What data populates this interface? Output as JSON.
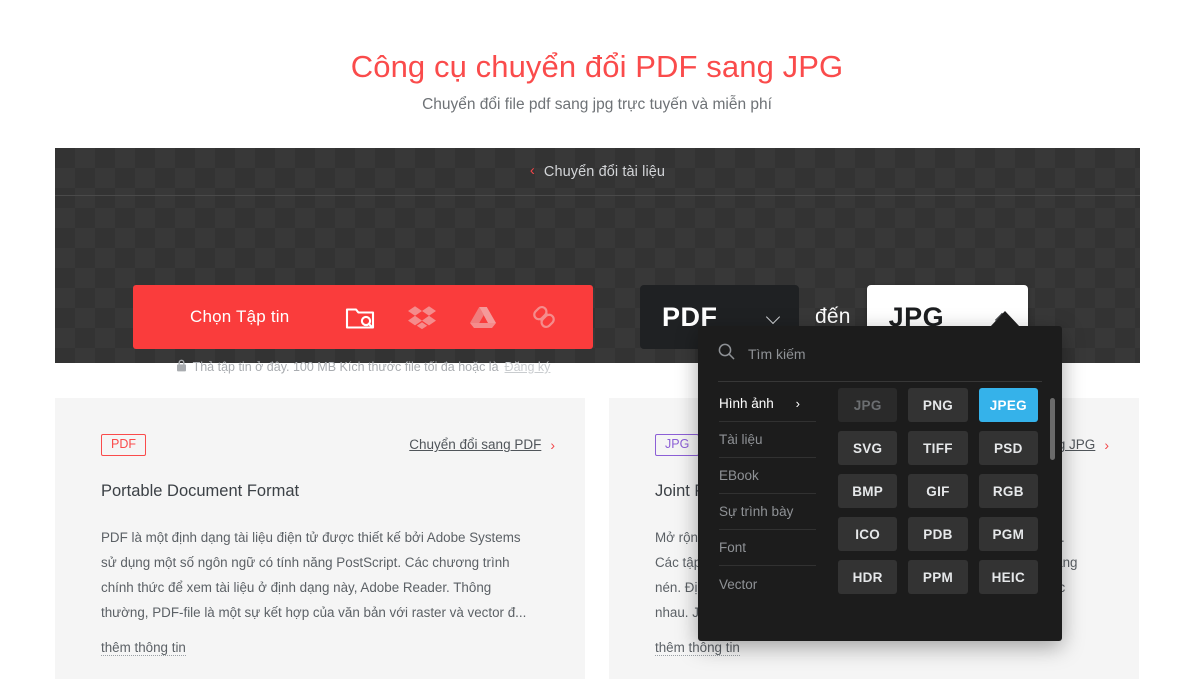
{
  "hero": {
    "title": "Công cụ chuyển đổi PDF sang JPG",
    "subtitle": "Chuyển đổi file pdf sang jpg trực tuyến và miễn phí"
  },
  "tool": {
    "header_label": "Chuyển đổi tài liệu",
    "back_chevron": "‹",
    "choose_button_label": "Chọn Tập tin",
    "source_icons": [
      {
        "name": "folder-search-icon"
      },
      {
        "name": "dropbox-icon"
      },
      {
        "name": "google-drive-icon"
      },
      {
        "name": "link-icon"
      }
    ],
    "drop_hint_text": "Thả tập tin ở đây. 100 MB Kích thước file tối đa hoặc là",
    "drop_hint_link": "Đăng ký",
    "lock_icon": "lock-icon",
    "format_from": "PDF",
    "format_to": "JPG",
    "between_label": "đến"
  },
  "dropdown": {
    "search_placeholder": "Tìm kiếm",
    "search_value": "",
    "search_icon": "search-icon",
    "categories": [
      {
        "label": "Hình ảnh",
        "active": true,
        "arrow": "›"
      },
      {
        "label": "Tài liệu",
        "active": false,
        "arrow": ""
      },
      {
        "label": "EBook",
        "active": false,
        "arrow": ""
      },
      {
        "label": "Sự trình bày",
        "active": false,
        "arrow": ""
      },
      {
        "label": "Font",
        "active": false,
        "arrow": ""
      },
      {
        "label": "Vector",
        "active": false,
        "arrow": ""
      }
    ],
    "formats": [
      {
        "label": "JPG",
        "state": "disabled"
      },
      {
        "label": "PNG",
        "state": "normal"
      },
      {
        "label": "JPEG",
        "state": "active"
      },
      {
        "label": "SVG",
        "state": "normal"
      },
      {
        "label": "TIFF",
        "state": "normal"
      },
      {
        "label": "PSD",
        "state": "normal"
      },
      {
        "label": "BMP",
        "state": "normal"
      },
      {
        "label": "GIF",
        "state": "normal"
      },
      {
        "label": "RGB",
        "state": "normal"
      },
      {
        "label": "ICO",
        "state": "normal"
      },
      {
        "label": "PDB",
        "state": "normal"
      },
      {
        "label": "PGM",
        "state": "normal"
      },
      {
        "label": "HDR",
        "state": "normal"
      },
      {
        "label": "PPM",
        "state": "normal"
      },
      {
        "label": "HEIC",
        "state": "normal"
      }
    ],
    "accent_color": "#35b2ea"
  },
  "cards": [
    {
      "badge": "PDF",
      "link_text": "Chuyển đổi sang PDF",
      "link_arrow": "›",
      "title": "Portable Document Format",
      "text": "PDF là một định dạng tài liệu điện tử được thiết kế bởi Adobe Systems sử dụng một số ngôn ngữ có tính năng PostScript. Các chương trình chính thức để xem tài liệu ở định dạng này, Adobe Reader. Thông thường, PDF-file là một sự kết hợp của văn bản với raster và vector đ...",
      "more_label": "thêm thông tin"
    },
    {
      "badge": "JPG",
      "link_text": "Chuyển đổi sang JPG",
      "link_arrow": "›",
      "title": "Joint Photographic Experts Group",
      "text": "Mở rộng này được gán cho các tập tin với hình ảnh raster và đồ họa. Các tập tin JPG có thể chứa hình ảnh chất lượng cao được lưu ở dạng nén. Định dạng này cho phép nén hình ảnh và tải về các thiết bị khác nhau. JPG hỗ trợ màu sắc 24-bit,...",
      "more_label": "thêm thông tin"
    }
  ],
  "colors": {
    "brand_red": "#fa4b4b",
    "button_red": "#fa3c3c",
    "panel_dark": "#333333",
    "dropdown_dark": "#1c1c1c",
    "chip_blue": "#35b2ea",
    "badge_purple": "#8c5fd6"
  }
}
